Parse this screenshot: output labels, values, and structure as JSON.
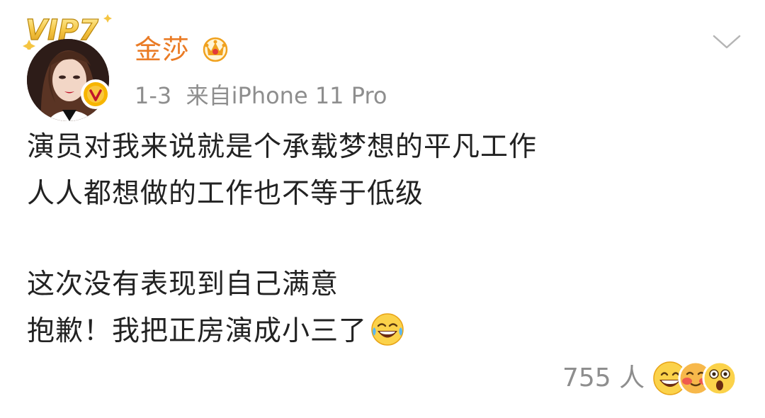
{
  "post": {
    "author_name": "金莎",
    "vip_badge": "VIP7",
    "date": "1-3",
    "source_prefix": "来自",
    "device": "iPhone 11 Pro",
    "lines": [
      "演员对我来说就是个承载梦想的平凡工作",
      "人人都想做的工作也不等于低级",
      "",
      "这次没有表现到自己满意",
      "抱歉！我把正房演成小三了"
    ],
    "reactions_count": "755",
    "reactions_unit": "人"
  },
  "icons": {
    "badge": "crown-icon",
    "verify": "verified-v-icon",
    "menu": "chevron-down-icon",
    "emoji": "laughing-tears-emoji",
    "reactions": [
      "grin-emoji",
      "blush-emoji",
      "surprised-emoji"
    ]
  },
  "colors": {
    "username": "#ea7b25",
    "meta": "#8e8e8e",
    "body": "#222222",
    "verify": "#f7b500"
  }
}
